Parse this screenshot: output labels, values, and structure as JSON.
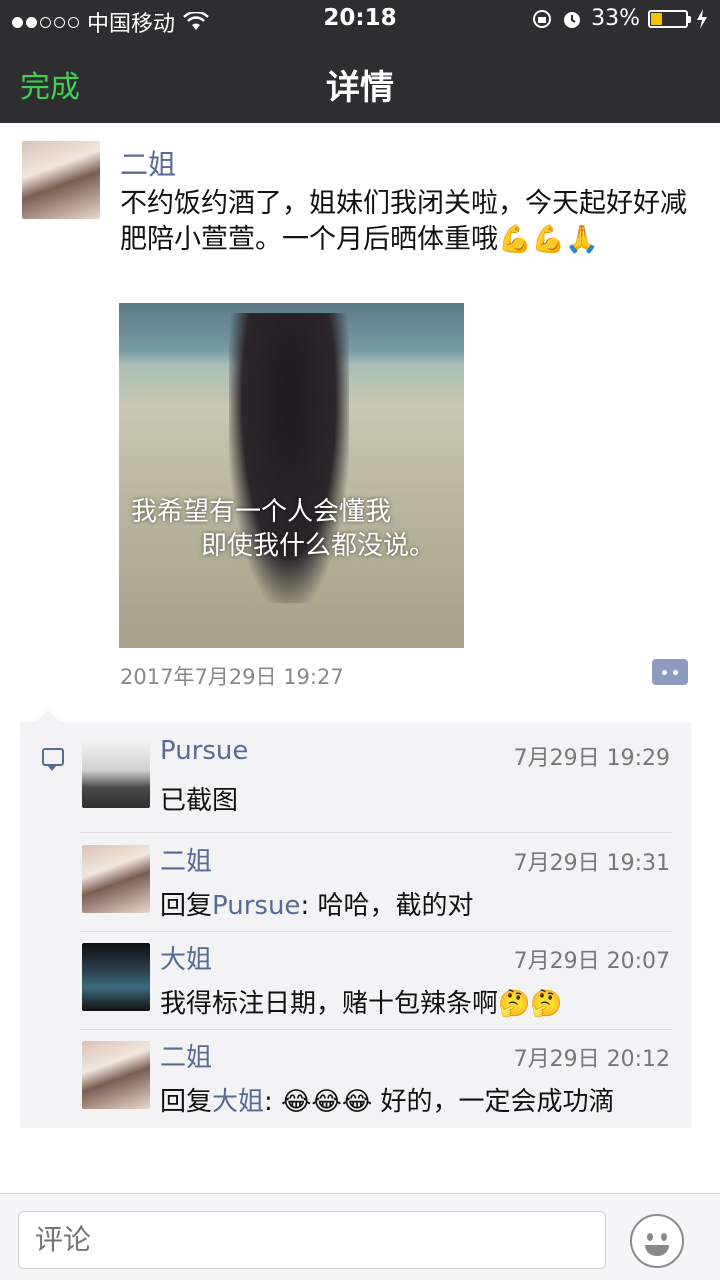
{
  "status_bar": {
    "carrier": "中国移动",
    "time": "20:18",
    "battery": "33%",
    "battery_level": 0.33
  },
  "nav": {
    "done_label": "完成",
    "title": "详情"
  },
  "post": {
    "author": "二姐",
    "text": "不约饭约酒了，姐妹们我闭关啦，今天起好好减肥陪小萱萱。一个月后晒体重哦💪💪🙏",
    "photo_caption_line1": "我希望有一个人会懂我",
    "photo_caption_line2": "即使我什么都没说。",
    "timestamp": "2017年7月29日 19:27"
  },
  "comments": [
    {
      "author": "Pursue",
      "time": "7月29日 19:29",
      "reply_to": "",
      "text": "已截图"
    },
    {
      "author": "二姐",
      "time": "7月29日 19:31",
      "reply_prefix": "回复",
      "reply_to": "Pursue",
      "text": ": 哈哈，截的对"
    },
    {
      "author": "大姐",
      "time": "7月29日 20:07",
      "reply_to": "",
      "text": "我得标注日期，赌十包辣条啊🤔🤔"
    },
    {
      "author": "二姐",
      "time": "7月29日 20:12",
      "reply_prefix": "回复",
      "reply_to": "大姐",
      "text": ": 😂😂😂 好的，一定会成功滴"
    }
  ],
  "input": {
    "placeholder": "评论"
  },
  "colors": {
    "nav_bg": "#2e2e31",
    "done_green": "#3fd152",
    "link_blue": "#576b95",
    "comment_bg": "#f3f3f5"
  }
}
